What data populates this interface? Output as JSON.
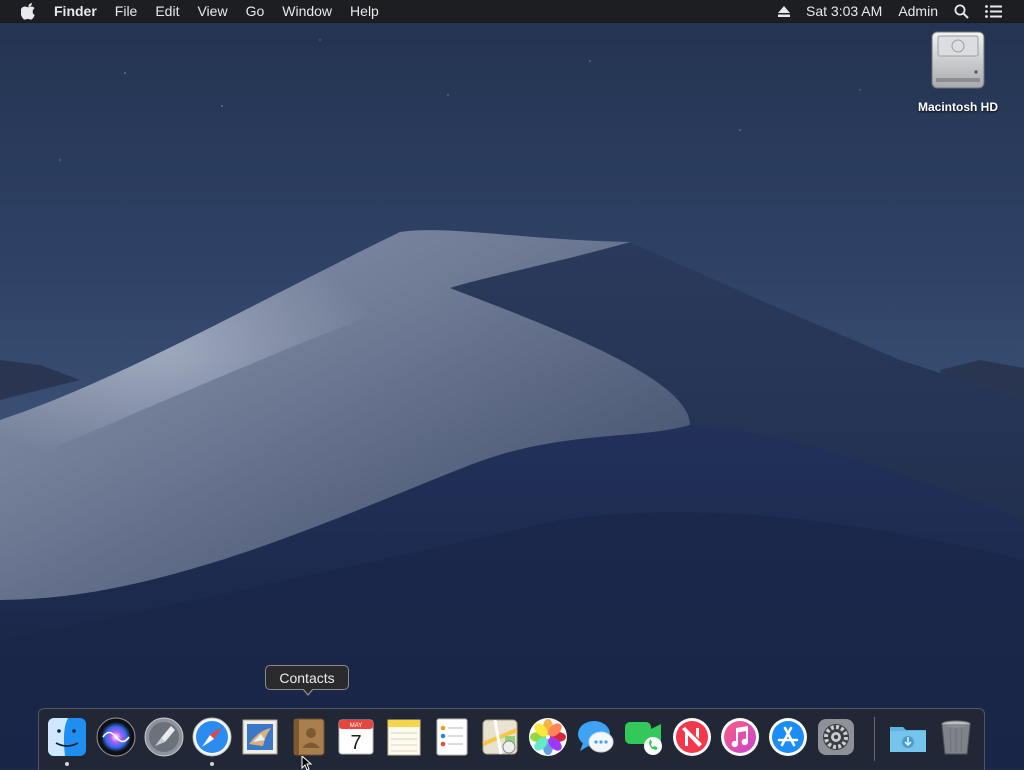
{
  "menubar": {
    "apple_icon": "apple-logo-icon",
    "app_name": "Finder",
    "menus": [
      "File",
      "Edit",
      "View",
      "Go",
      "Window",
      "Help"
    ],
    "status": {
      "eject_icon": "eject-icon",
      "clock": "Sat 3:03 AM",
      "user": "Admin",
      "search_icon": "spotlight-search-icon",
      "notifications_icon": "notification-center-icon"
    }
  },
  "desktop": {
    "icons": [
      {
        "label": "Macintosh HD",
        "icon": "hard-drive-icon"
      }
    ]
  },
  "dock": {
    "tooltip": "Contacts",
    "calendar": {
      "month": "MAY",
      "day": "7"
    },
    "apps": [
      {
        "name": "Finder",
        "icon": "finder-icon",
        "running": true
      },
      {
        "name": "Siri",
        "icon": "siri-icon",
        "running": false
      },
      {
        "name": "Launchpad",
        "icon": "launchpad-icon",
        "running": false
      },
      {
        "name": "Safari",
        "icon": "safari-icon",
        "running": true
      },
      {
        "name": "Mail",
        "icon": "mail-icon",
        "running": false
      },
      {
        "name": "Contacts",
        "icon": "contacts-icon",
        "running": false
      },
      {
        "name": "Calendar",
        "icon": "calendar-icon",
        "running": false
      },
      {
        "name": "Notes",
        "icon": "notes-icon",
        "running": false
      },
      {
        "name": "Reminders",
        "icon": "reminders-icon",
        "running": false
      },
      {
        "name": "Maps",
        "icon": "maps-icon",
        "running": false
      },
      {
        "name": "Photos",
        "icon": "photos-icon",
        "running": false
      },
      {
        "name": "Messages",
        "icon": "messages-icon",
        "running": false
      },
      {
        "name": "FaceTime",
        "icon": "facetime-icon",
        "running": false
      },
      {
        "name": "News",
        "icon": "news-icon",
        "running": false
      },
      {
        "name": "iTunes",
        "icon": "itunes-icon",
        "running": false
      },
      {
        "name": "App Store",
        "icon": "app-store-icon",
        "running": false
      },
      {
        "name": "System Preferences",
        "icon": "system-preferences-icon",
        "running": false
      }
    ],
    "stack": [
      {
        "name": "Downloads",
        "icon": "downloads-folder-icon"
      },
      {
        "name": "Trash",
        "icon": "trash-icon"
      }
    ]
  }
}
